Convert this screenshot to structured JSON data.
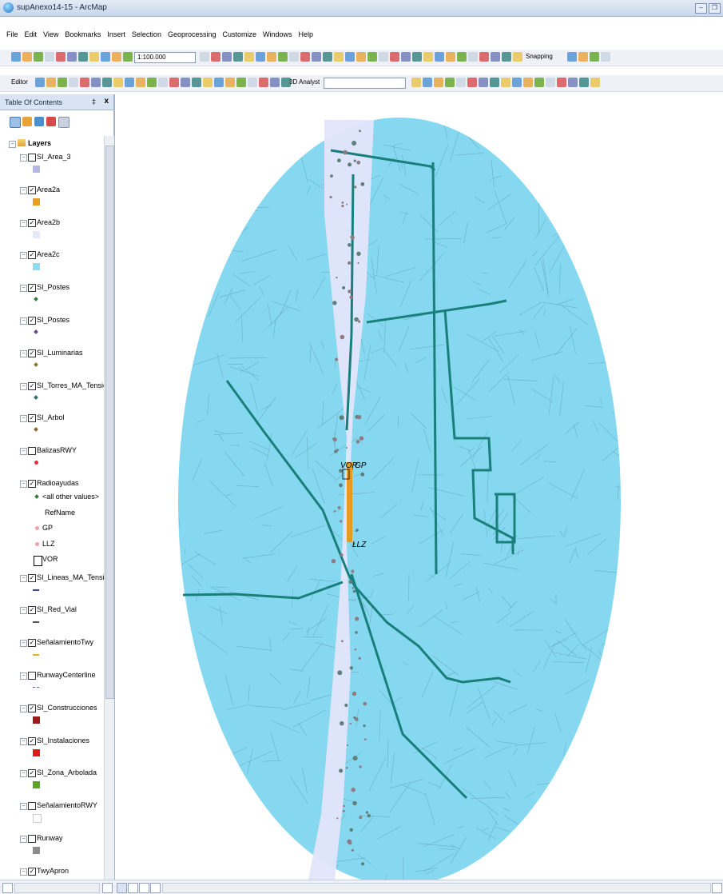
{
  "window": {
    "title": "supAnexo14-15 - ArcMap"
  },
  "menu": [
    "File",
    "Edit",
    "View",
    "Bookmarks",
    "Insert",
    "Selection",
    "Geoprocessing",
    "Customize",
    "Windows",
    "Help"
  ],
  "toolbar": {
    "scale": "1:100.000",
    "snapping_label": "Snapping",
    "editor_label": "Editor",
    "analyst_label": "3D Analyst"
  },
  "toc": {
    "title": "Table Of Contents",
    "pin": "‡",
    "close": "x",
    "root": "Layers",
    "layers": [
      {
        "name": "SI_Area_3",
        "checked": false,
        "sym": "square",
        "color": "#b4b6e6"
      },
      {
        "name": "Area2a",
        "checked": true,
        "sym": "square",
        "color": "#e8a21a"
      },
      {
        "name": "Area2b",
        "checked": true,
        "sym": "square",
        "color": "#e5e8fb"
      },
      {
        "name": "Area2c",
        "checked": true,
        "sym": "square",
        "color": "#8fdcf2"
      },
      {
        "name": "SI_Postes",
        "checked": true,
        "sym": "diamond",
        "color": "#2f7e3a"
      },
      {
        "name": "SI_Postes",
        "checked": true,
        "sym": "diamond",
        "color": "#6a3f8e"
      },
      {
        "name": "SI_Luminarias",
        "checked": true,
        "sym": "diamond",
        "color": "#7c7a2a"
      },
      {
        "name": "SI_Torres_MA_Tension",
        "checked": true,
        "sym": "diamond",
        "color": "#2f6e6a"
      },
      {
        "name": "SI_Arbol",
        "checked": true,
        "sym": "diamond",
        "color": "#8a6b2a"
      },
      {
        "name": "BalizasRWY",
        "checked": false,
        "sym": "dot",
        "color": "#e0323c"
      },
      {
        "name": "Radioayudas",
        "checked": true,
        "sym": "none",
        "color": "#000000"
      },
      {
        "name": "SI_Lineas_MA_Tension",
        "checked": true,
        "sym": "line",
        "color": "#3148a8"
      },
      {
        "name": "SI_Red_Vial",
        "checked": true,
        "sym": "line",
        "color": "#555555"
      },
      {
        "name": "SeñalamientoTwy",
        "checked": true,
        "sym": "line",
        "color": "#e1b32a"
      },
      {
        "name": "RunwayCenterline",
        "checked": false,
        "sym": "dash",
        "color": "#e0323c"
      },
      {
        "name": "SI_Construcciones",
        "checked": true,
        "sym": "square",
        "color": "#9c1b1b"
      },
      {
        "name": "SI_Instalaciones",
        "checked": true,
        "sym": "square",
        "color": "#e5171d"
      },
      {
        "name": "SI_Zona_Arbolada",
        "checked": true,
        "sym": "square",
        "color": "#5ea327"
      },
      {
        "name": "SeñalamientoRWY",
        "checked": false,
        "sym": "square",
        "color": "#ffffff"
      },
      {
        "name": "Runway",
        "checked": false,
        "sym": "square",
        "color": "#8c8c8c"
      },
      {
        "name": "TwyApron",
        "checked": true,
        "sym": "none",
        "color": "#888888"
      }
    ],
    "radio_items": [
      {
        "label": "<all other values>",
        "sym": "diamond",
        "color": "#2f7e3a"
      },
      {
        "label": "RefName",
        "sym": "none",
        "color": "#000000"
      },
      {
        "label": "GP",
        "sym": "dot",
        "color": "#f0a0a8"
      },
      {
        "label": "LLZ",
        "sym": "dot",
        "color": "#f0a0a8"
      },
      {
        "label": "VOR",
        "sym": "square-outline",
        "color": "#000000"
      }
    ]
  },
  "map": {
    "labels": {
      "vor": "VOR",
      "gp": "GP",
      "llz": "LLZ"
    },
    "colors": {
      "buffer": "#85d8ef",
      "corridor": "#e3e6fb",
      "line": "#187f7a",
      "runway": "#e69a1e"
    }
  }
}
